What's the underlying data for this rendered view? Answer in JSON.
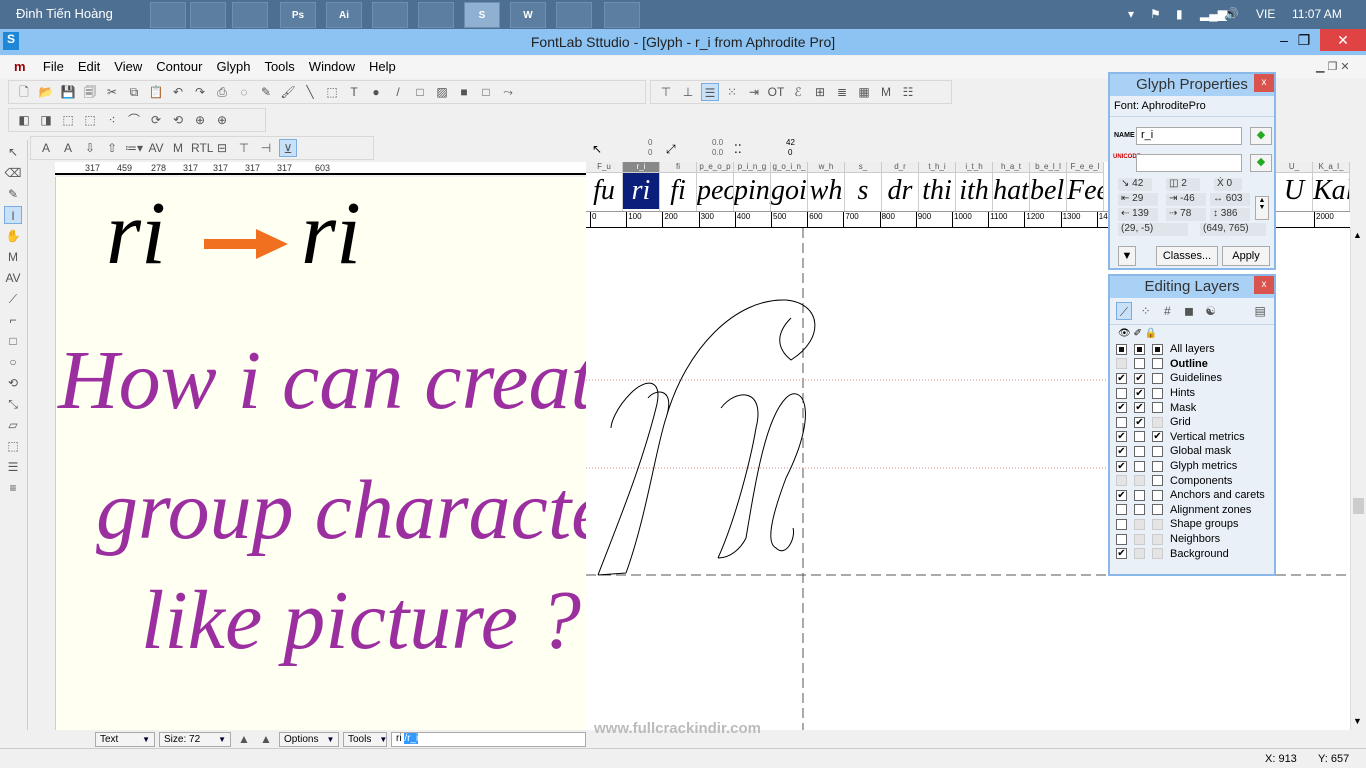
{
  "taskbar": {
    "user": "Đinh Tiến Hoàng",
    "apps": [
      {
        "icon": "remote-desktop-icon",
        "label": ""
      },
      {
        "icon": "media-player-icon",
        "label": ""
      },
      {
        "icon": "file-explorer-icon",
        "label": ""
      },
      {
        "icon": "photoshop-icon",
        "label": "Ps"
      },
      {
        "icon": "illustrator-icon",
        "label": "Ai"
      },
      {
        "icon": "firefox-icon",
        "label": ""
      },
      {
        "icon": "chrome-icon",
        "label": ""
      },
      {
        "icon": "fontlab-icon",
        "label": "S"
      },
      {
        "icon": "word-icon",
        "label": "W"
      },
      {
        "icon": "acrobat-icon",
        "label": ""
      },
      {
        "icon": "pdf-icon",
        "label": ""
      }
    ],
    "language": "VIE",
    "time": "11:07 AM"
  },
  "window": {
    "title": "FontLab Sttudio - [Glyph - r_i from Aphrodite Pro]"
  },
  "menu": [
    "File",
    "Edit",
    "View",
    "Contour",
    "Glyph",
    "Tools",
    "Window",
    "Help"
  ],
  "metrics_row": [
    "317",
    "459",
    "278",
    "317",
    "317",
    "317",
    "317",
    "603"
  ],
  "text_panel": {
    "before": "ri",
    "after": "ri",
    "question": [
      "How i can create",
      "group character",
      "like picture ?"
    ],
    "accent": "#9b2fa0",
    "arrow_color": "#f07020"
  },
  "info_bar": {
    "x": "0",
    "y": "0",
    "dx": "0.0",
    "dy": "0.0",
    "nodes": "42",
    "sel": "0"
  },
  "glyph_strip": [
    {
      "name": "F_u",
      "text": "fu"
    },
    {
      "name": "r_i",
      "text": "ri",
      "selected": true
    },
    {
      "name": "fi",
      "text": "fi"
    },
    {
      "name": "p_e_o_p",
      "text": "peop"
    },
    {
      "name": "p_i_n_g",
      "text": "ping"
    },
    {
      "name": "g_o_i_n_",
      "text": "goin"
    },
    {
      "name": "w_h",
      "text": "wh"
    },
    {
      "name": "s_",
      "text": "s"
    },
    {
      "name": "d_r",
      "text": "dr"
    },
    {
      "name": "t_h_i",
      "text": "thi"
    },
    {
      "name": "i_t_h",
      "text": "ith"
    },
    {
      "name": "h_a_t",
      "text": "hat"
    },
    {
      "name": "b_e_l_l",
      "text": "bell"
    },
    {
      "name": "F_e_e_l",
      "text": "Feel"
    }
  ],
  "glyph_strip_right": [
    {
      "name": "U_",
      "text": "U"
    },
    {
      "name": "K_a_l_",
      "text": "Kali"
    }
  ],
  "ruler_ticks": [
    "0",
    "100",
    "200",
    "300",
    "400",
    "500",
    "600",
    "700",
    "800",
    "900",
    "1000",
    "1100",
    "1200",
    "1300",
    "1400",
    "2000"
  ],
  "glyph_properties": {
    "title": "Glyph Properties",
    "font_label": "Font:",
    "font": "AphroditePro",
    "name_label": "NAME",
    "name": "r_i",
    "unicode_label": "UNICODE",
    "unicode": "",
    "nodes": "42",
    "contours": "2",
    "hints": "0",
    "lsb": "29",
    "rsb": "-46",
    "width": "603",
    "left": "139",
    "right": "78",
    "height": "386",
    "bbox_min": "(29, -5)",
    "bbox_max": "(649, 765)",
    "classes_button": "Classes...",
    "apply_button": "Apply"
  },
  "editing_layers": {
    "title": "Editing Layers",
    "all_label": "All layers",
    "layers": [
      {
        "name": "Outline",
        "bold": true,
        "v": "d",
        "e": "u",
        "l": "u"
      },
      {
        "name": "Guidelines",
        "v": "c",
        "e": "c",
        "l": "u"
      },
      {
        "name": "Hints",
        "v": "u",
        "e": "c",
        "l": "u"
      },
      {
        "name": "Mask",
        "v": "c",
        "e": "c",
        "l": "u"
      },
      {
        "name": "Grid",
        "v": "u",
        "e": "c",
        "l": "d"
      },
      {
        "name": "Vertical metrics",
        "v": "c",
        "e": "u",
        "l": "c"
      },
      {
        "name": "Global mask",
        "v": "c",
        "e": "u",
        "l": "u"
      },
      {
        "name": "Glyph metrics",
        "v": "c",
        "e": "u",
        "l": "u"
      },
      {
        "name": "Components",
        "v": "d",
        "e": "d",
        "l": "u"
      },
      {
        "name": "Anchors and carets",
        "v": "c",
        "e": "u",
        "l": "u"
      },
      {
        "name": "Alignment zones",
        "v": "u",
        "e": "u",
        "l": "u"
      },
      {
        "name": "Shape groups",
        "v": "u",
        "e": "d",
        "l": "d"
      },
      {
        "name": "Neighbors",
        "v": "u",
        "e": "d",
        "l": "d"
      },
      {
        "name": "Background",
        "v": "c",
        "e": "d",
        "l": "d"
      }
    ]
  },
  "bottom_bar": {
    "mode": "Text",
    "size": "Size: 72",
    "options": "Options",
    "tools": "Tools",
    "text_value": "ri",
    "text_selected": "/r_i"
  },
  "watermark": "www.fullcrackindir.com",
  "status": {
    "x": "X: 913",
    "y": "Y: 657"
  }
}
